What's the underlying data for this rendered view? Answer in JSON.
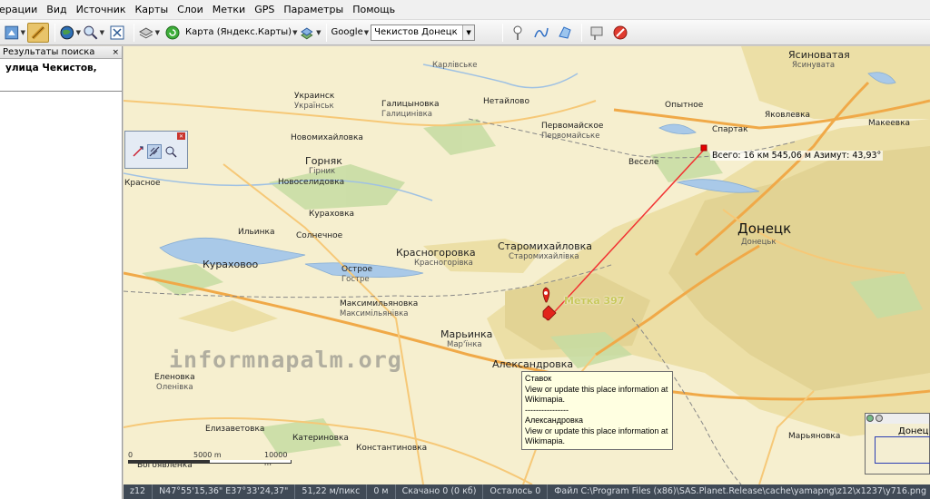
{
  "menu": [
    "ерации",
    "Вид",
    "Источник",
    "Карты",
    "Слои",
    "Метки",
    "GPS",
    "Параметры",
    "Помощь"
  ],
  "toolbar": {
    "map_source_label": "Карта (Яндекс.Карты)",
    "search_engine_label": "Google",
    "search_value": "Чекистов Донецк",
    "icons": [
      "move-select-icon",
      "ruler-icon",
      "globe-icon",
      "zoom-icon",
      "fullscreen-icon",
      "layers-icon",
      "refresh-icon",
      "map-layers-icon",
      "pin-icon",
      "path-icon",
      "polygon-icon",
      "marks-icon",
      "delete-icon"
    ]
  },
  "left_panel": {
    "title": "Результаты поиска",
    "close": "×",
    "result": "улица Чекистов,"
  },
  "map": {
    "labels": [
      {
        "text": "Ясиноватая",
        "cls": "big"
      },
      {
        "text": "Ясинувата",
        "cls": "sub"
      },
      {
        "text": "Украинск",
        "cls": ""
      },
      {
        "text": "Українськ",
        "cls": "sub"
      },
      {
        "text": "Галицыновка",
        "cls": ""
      },
      {
        "text": "Галицинівка",
        "cls": "sub"
      },
      {
        "text": "Первомайское",
        "cls": ""
      },
      {
        "text": "Первомайське",
        "cls": "sub"
      },
      {
        "text": "Опытное",
        "cls": ""
      },
      {
        "text": "Спартак",
        "cls": ""
      },
      {
        "text": "Горняк",
        "cls": ""
      },
      {
        "text": "Гірник",
        "cls": "sub"
      },
      {
        "text": "Новоселидовка",
        "cls": ""
      },
      {
        "text": "Курахово",
        "cls": ""
      },
      {
        "text": "Красногоровка",
        "cls": "big"
      },
      {
        "text": "Красногорівка",
        "cls": "sub"
      },
      {
        "text": "Старомихайловка",
        "cls": "big"
      },
      {
        "text": "Старомихайлівка",
        "cls": "sub"
      },
      {
        "text": "Донецк",
        "cls": "city"
      },
      {
        "text": "Донецьк",
        "cls": "sub"
      },
      {
        "text": "Кураховоo",
        "cls": "big"
      },
      {
        "text": "Острое",
        "cls": ""
      },
      {
        "text": "Гостре",
        "cls": "sub"
      },
      {
        "text": "Максимильяновка",
        "cls": ""
      },
      {
        "text": "Максимільянівка",
        "cls": "sub"
      },
      {
        "text": "Марьинка",
        "cls": "big"
      },
      {
        "text": "Мар'їнка",
        "cls": "sub"
      },
      {
        "text": "Александровка",
        "cls": "big"
      },
      {
        "text": "Еленовка",
        "cls": ""
      },
      {
        "text": "Оленівка",
        "cls": "sub"
      },
      {
        "text": "Елизаветовка",
        "cls": ""
      },
      {
        "text": "Катериновка",
        "cls": ""
      },
      {
        "text": "Константиновка",
        "cls": ""
      },
      {
        "text": "Марьяновка",
        "cls": ""
      },
      {
        "text": "Богоявленка",
        "cls": ""
      },
      {
        "text": "Красное",
        "cls": ""
      },
      {
        "text": "Ильинка",
        "cls": ""
      },
      {
        "text": "Кураховка",
        "cls": ""
      },
      {
        "text": "Новомихайловка",
        "cls": ""
      },
      {
        "text": "Солнечное",
        "cls": ""
      },
      {
        "text": "Нетайлово",
        "cls": ""
      },
      {
        "text": "Карлівське",
        "cls": "sub"
      },
      {
        "text": "Веселе",
        "cls": ""
      },
      {
        "text": "Яковлевка",
        "cls": ""
      },
      {
        "text": "Макеевка",
        "cls": ""
      }
    ],
    "measure": "Всего: 16 км 545,06 м Азимут: 43,93°",
    "mark": "Метка 397",
    "watermark": "informnapalm.org",
    "popup": {
      "title1": "Ставок",
      "body1": "View or update this place information at Wikimapia.",
      "divider": "----------------",
      "title2": "Александровка",
      "body2": "View or update this place information at Wikimapia."
    },
    "scale": [
      "0",
      "5000 m",
      "10000 m"
    ],
    "minimap_label": "Донец"
  },
  "status": {
    "zoom": "z12",
    "coords": "N47°55'15,36\" E37°33'24,37\"",
    "resolution": "51,22 м/пикс",
    "distance": "0 м",
    "downloaded": "Скачано 0 (0 кб)",
    "remaining": "Осталось 0",
    "file": "Файл C:\\Program Files (x86)\\SAS.Planet.Release\\cache\\yamapng\\z12\\x1237\\y716.png"
  }
}
